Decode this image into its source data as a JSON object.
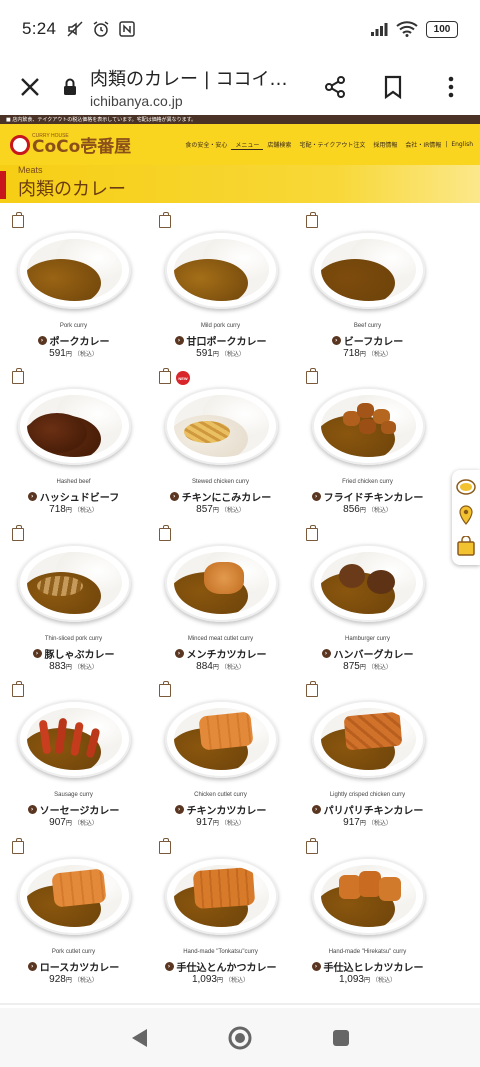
{
  "status": {
    "time": "5:24",
    "battery": "100"
  },
  "browser": {
    "page_title": "肉類のカレー | ココイ…",
    "domain": "ichibanya.co.jp"
  },
  "site": {
    "notice": "■ 店内飲食、テイクアウトの税込価格を表示しています。宅配は価格が異なります。",
    "logo_small": "CURRY HOUSE",
    "logo_main": "CoCo壱番屋",
    "nav": [
      "食の安全・安心",
      "メニュー",
      "店舗検索",
      "宅配・テイクアウト注文",
      "採用情報",
      "会社・IR情報",
      "English"
    ],
    "hero_sub": "Meats",
    "hero_title": "肉類のカレー"
  },
  "menu": [
    {
      "en": "Pork curry",
      "jp": "ポークカレー",
      "price": "591",
      "yen": "円",
      "tax": "（税込）",
      "new": false,
      "topping": "none",
      "curry_color": "#9a6414"
    },
    {
      "en": "Mild pork curry",
      "jp": "甘口ポークカレー",
      "price": "591",
      "yen": "円",
      "tax": "（税込）",
      "new": false,
      "topping": "none",
      "curry_color": "#a56f18"
    },
    {
      "en": "Beef curry",
      "jp": "ビーフカレー",
      "price": "718",
      "yen": "円",
      "tax": "（税込）",
      "new": false,
      "topping": "none",
      "curry_color": "#7d4b0c"
    },
    {
      "en": "Hashed beef",
      "jp": "ハッシュドビーフ",
      "price": "718",
      "yen": "円",
      "tax": "（税込）",
      "new": false,
      "topping": "hashed",
      "curry_color": "#5a2a10"
    },
    {
      "en": "Stewed chicken curry",
      "jp": "チキンにこみカレー",
      "price": "857",
      "yen": "円",
      "tax": "（税込）",
      "new": true,
      "new_label": "NEW",
      "topping": "stew",
      "curry_color": "#c48a22"
    },
    {
      "en": "Fried chicken curry",
      "jp": "フライドチキンカレー",
      "price": "856",
      "yen": "円",
      "tax": "（税込）",
      "new": false,
      "topping": "karaage",
      "curry_color": "#8a560e"
    },
    {
      "en": "Thin-sliced pork curry",
      "jp": "豚しゃぶカレー",
      "price": "883",
      "yen": "円",
      "tax": "（税込）",
      "new": false,
      "topping": "slices",
      "curry_color": "#8e5a10"
    },
    {
      "en": "Minced meat cutlet curry",
      "jp": "メンチカツカレー",
      "price": "884",
      "yen": "円",
      "tax": "（税込）",
      "new": false,
      "topping": "menchi",
      "curry_color": "#8a560e"
    },
    {
      "en": "Hamburger curry",
      "jp": "ハンバーグカレー",
      "price": "875",
      "yen": "円",
      "tax": "（税込）",
      "new": false,
      "topping": "hamburg",
      "curry_color": "#8a560e"
    },
    {
      "en": "Sausage curry",
      "jp": "ソーセージカレー",
      "price": "907",
      "yen": "円",
      "tax": "（税込）",
      "new": false,
      "topping": "sausage",
      "curry_color": "#8a560e"
    },
    {
      "en": "Chicken cutlet curry",
      "jp": "チキンカツカレー",
      "price": "917",
      "yen": "円",
      "tax": "（税込）",
      "new": false,
      "topping": "katsu",
      "curry_color": "#8a560e"
    },
    {
      "en": "Lightly crisped chicken curry",
      "jp": "パリパリチキンカレー",
      "price": "917",
      "yen": "円",
      "tax": "（税込）",
      "new": false,
      "topping": "pari",
      "curry_color": "#8a560e"
    },
    {
      "en": "Pork cutlet curry",
      "jp": "ロースカツカレー",
      "price": "928",
      "yen": "円",
      "tax": "（税込）",
      "new": false,
      "topping": "katsu",
      "curry_color": "#8a560e"
    },
    {
      "en": "Hand-made \"Tonkatsu\"curry",
      "jp": "手仕込とんかつカレー",
      "price": "1,093",
      "yen": "円",
      "tax": "（税込）",
      "new": false,
      "topping": "katsu-big",
      "curry_color": "#8a560e"
    },
    {
      "en": "Hand-made \"Hirekatsu\" curry",
      "jp": "手仕込ヒレカツカレー",
      "price": "1,093",
      "yen": "円",
      "tax": "（税込）",
      "new": false,
      "topping": "hire",
      "curry_color": "#8a560e"
    }
  ],
  "takeout_label": "TAKE OUT",
  "colors": {
    "header_yellow": "#f9d51f",
    "brand_brown": "#6b3b12",
    "brand_red": "#c8161d"
  }
}
